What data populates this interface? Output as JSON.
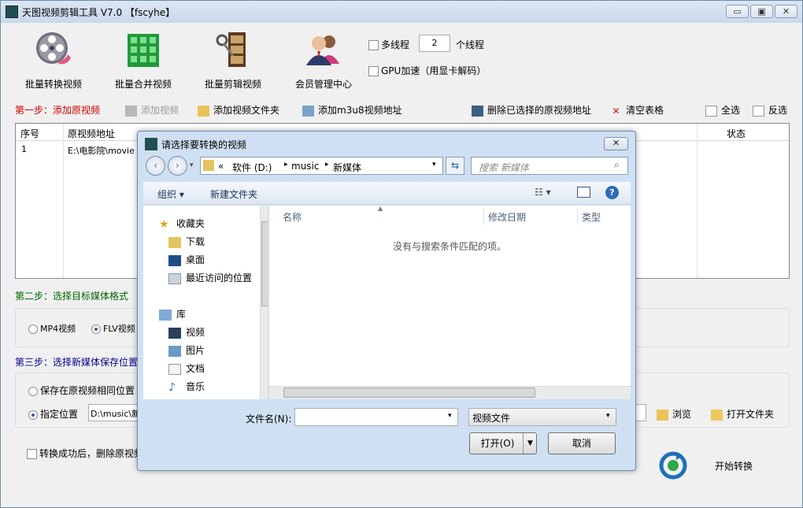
{
  "app": {
    "title": "天图视频剪辑工具 V7.0 【fscyhe】",
    "window_controls": {
      "minimize": "▭",
      "restore": "▣",
      "close": "✕"
    }
  },
  "toolbar": {
    "batch_convert": "批量转换视频",
    "batch_merge": "批量合并视频",
    "batch_cut": "批量剪辑视频",
    "member": "会员管理中心",
    "multithread_label": "多线程",
    "thread_count": "2",
    "thread_suffix": "个线程",
    "gpu_label": "GPU加速（用显卡解码）"
  },
  "step1": {
    "label": "第一步：添加原视频",
    "add_video": "添加视频",
    "add_folder": "添加视频文件夹",
    "add_m3u8": "添加m3u8视频地址",
    "delete_selected": "删除已选择的原视频地址",
    "clear_table": "清空表格",
    "select_all": "全选",
    "invert": "反选"
  },
  "table": {
    "columns": [
      "序号",
      "原视频地址",
      "状态"
    ],
    "rows": [
      {
        "index": "1",
        "path": "E:\\电影院\\movie"
      }
    ]
  },
  "step2": {
    "label": "第二步：选择目标媒体格式",
    "mp4": "MP4视频",
    "flv": "FLV视频"
  },
  "step3": {
    "label": "第三步：选择新媒体保存位置",
    "same_location": "保存在原视频相同位置",
    "specify": "指定位置",
    "path": "D:\\music\\新",
    "browse": "浏览",
    "open_folder": "打开文件夹"
  },
  "bottom": {
    "delete_after": "转换成功后，删除原视频",
    "start": "开始转换"
  },
  "dialog": {
    "title": "请选择要转换的视频",
    "close": "✕",
    "breadcrumb": [
      "«",
      "软件 (D:)",
      "music",
      "新媒体"
    ],
    "search_placeholder": "搜索 新媒体",
    "organize": "组织 ▾",
    "new_folder": "新建文件夹",
    "nav": {
      "favorites": "收藏夹",
      "downloads": "下载",
      "desktop": "桌面",
      "recent": "最近访问的位置",
      "libraries": "库",
      "videos": "视频",
      "pictures": "图片",
      "documents": "文档",
      "music": "音乐"
    },
    "columns": {
      "name": "名称",
      "modified": "修改日期",
      "type": "类型"
    },
    "empty_message": "没有与搜索条件匹配的项。",
    "filename_label": "文件名(N):",
    "filename_value": "",
    "filter": "视频文件",
    "open": "打开(O)",
    "cancel": "取消"
  }
}
